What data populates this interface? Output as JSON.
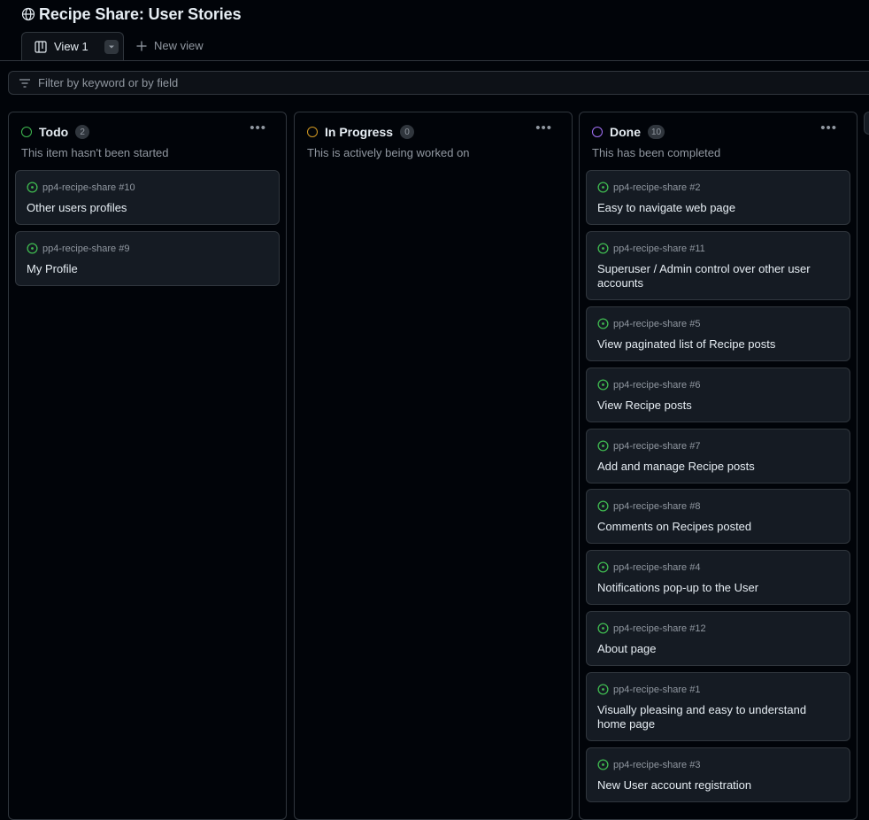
{
  "header": {
    "title": "Recipe Share: User Stories",
    "icon": "globe-icon"
  },
  "tabs": [
    {
      "label": "View 1",
      "active": true
    }
  ],
  "new_view_label": "New view",
  "filter": {
    "placeholder": "Filter by keyword or by field"
  },
  "colors": {
    "accent_green": "#3fb950",
    "accent_orange": "#d29922",
    "accent_purple": "#a371f7",
    "background": "#010409",
    "card": "#151b23"
  },
  "columns": [
    {
      "name": "Todo",
      "count": "2",
      "description": "This item hasn't been started",
      "status_color": "#3fb950",
      "cards": [
        {
          "ref": "pp4-recipe-share #10",
          "title": "Other users profiles"
        },
        {
          "ref": "pp4-recipe-share #9",
          "title": "My Profile"
        }
      ]
    },
    {
      "name": "In Progress",
      "count": "0",
      "description": "This is actively being worked on",
      "status_color": "#d29922",
      "cards": []
    },
    {
      "name": "Done",
      "count": "10",
      "description": "This has been completed",
      "status_color": "#a371f7",
      "cards": [
        {
          "ref": "pp4-recipe-share #2",
          "title": "Easy to navigate web page"
        },
        {
          "ref": "pp4-recipe-share #11",
          "title": "Superuser / Admin control over other user accounts"
        },
        {
          "ref": "pp4-recipe-share #5",
          "title": "View paginated list of Recipe posts"
        },
        {
          "ref": "pp4-recipe-share #6",
          "title": "View Recipe posts"
        },
        {
          "ref": "pp4-recipe-share #7",
          "title": "Add and manage Recipe posts"
        },
        {
          "ref": "pp4-recipe-share #8",
          "title": "Comments on Recipes posted"
        },
        {
          "ref": "pp4-recipe-share #4",
          "title": "Notifications pop-up to the User"
        },
        {
          "ref": "pp4-recipe-share #12",
          "title": "About page"
        },
        {
          "ref": "pp4-recipe-share #1",
          "title": "Visually pleasing and easy to understand home page"
        },
        {
          "ref": "pp4-recipe-share #3",
          "title": "New User account registration"
        }
      ]
    }
  ]
}
